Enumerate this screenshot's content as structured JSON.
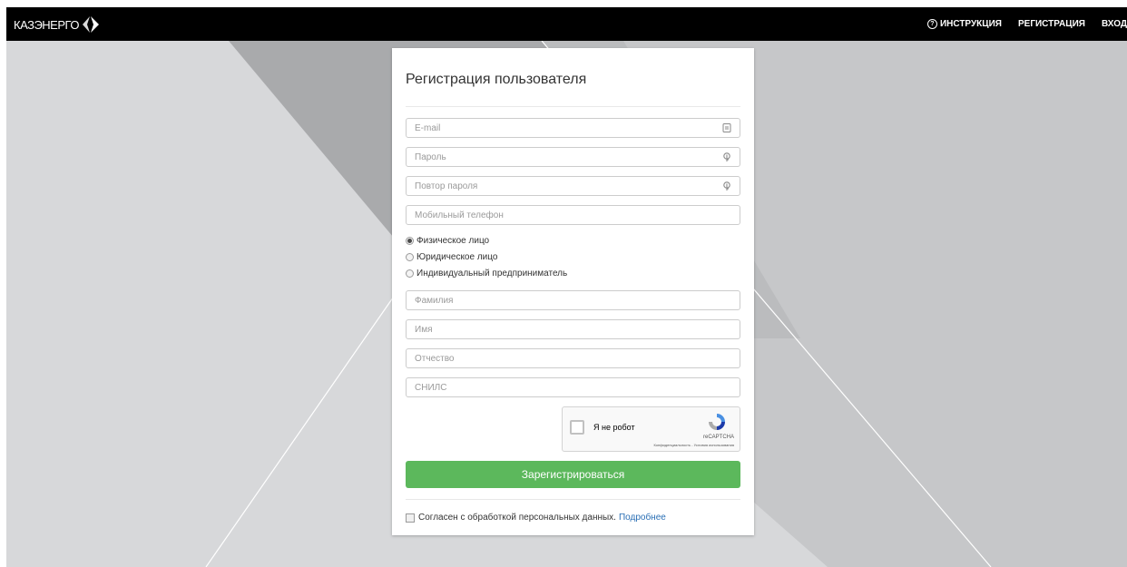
{
  "header": {
    "logo_text": "КАЗЭНЕРГО",
    "nav": {
      "instruction": "ИНСТРУКЦИЯ",
      "register": "РЕГИСТРАЦИЯ",
      "login": "ВХОД"
    }
  },
  "form": {
    "title": "Регистрация пользователя",
    "email_placeholder": "E-mail",
    "password_placeholder": "Пароль",
    "password_repeat_placeholder": "Повтор пароля",
    "phone_placeholder": "Мобильный телефон",
    "person_types": [
      {
        "label": "Физическое лицо",
        "checked": true
      },
      {
        "label": "Юридическое лицо",
        "checked": false
      },
      {
        "label": "Индивидуальный предприниматель",
        "checked": false
      }
    ],
    "last_name_placeholder": "Фамилия",
    "first_name_placeholder": "Имя",
    "middle_name_placeholder": "Отчество",
    "snils_placeholder": "СНИЛС",
    "captcha": {
      "label": "Я не робот",
      "brand": "reCAPTCHA",
      "terms": "Конфиденциальность - Условия использования"
    },
    "submit_label": "Зарегистрироваться",
    "agree_text": "Согласен с обработкой персональных данных.",
    "agree_link": "Подробнее"
  },
  "colors": {
    "topbar": "#000000",
    "submit": "#5cb85c",
    "link": "#2a6fb5",
    "background": "#d6d7d9"
  }
}
